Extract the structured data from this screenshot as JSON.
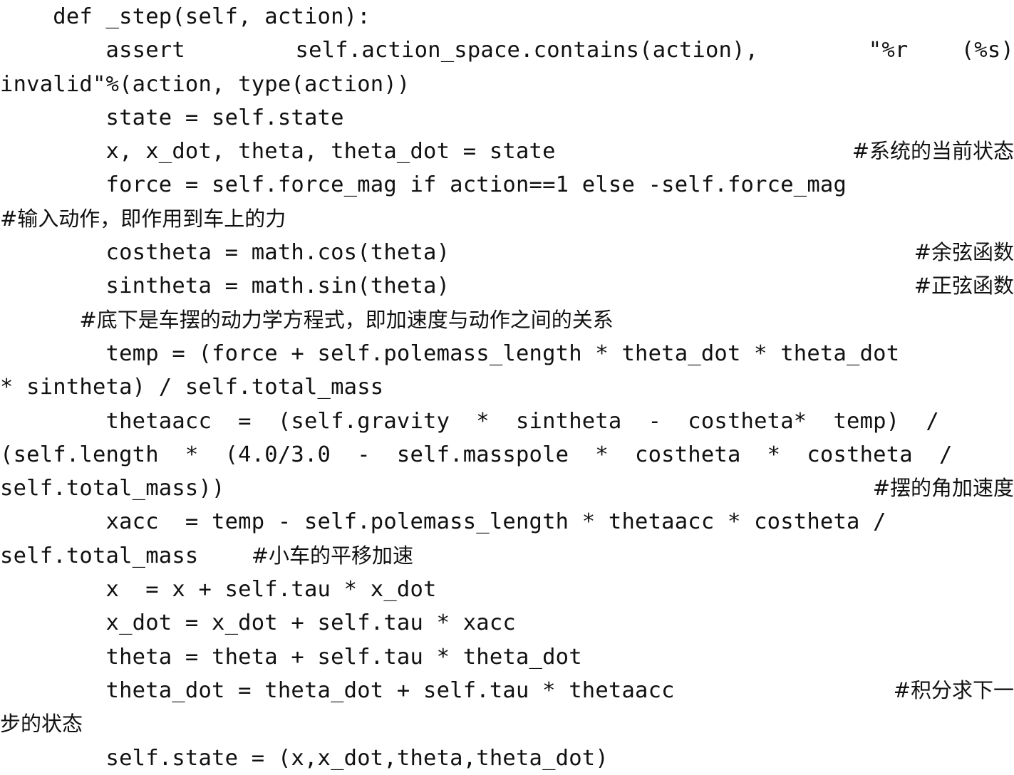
{
  "document": {
    "kind": "source-code-listing",
    "language": "Python",
    "function_name": "_step",
    "background_color": "#ffffff",
    "text_color": "#111111",
    "font_style": "monospace-serif",
    "text_alignment": "justified",
    "lines": [
      {
        "id": "line-1",
        "indent": "    ",
        "code": "def _step(self, action):",
        "comment": ""
      },
      {
        "id": "line-2",
        "indent": "        ",
        "code_left": "assert",
        "code_mid": "self.action_space.contains(action),",
        "code_right": "\"%r    (%s)",
        "comment": ""
      },
      {
        "id": "line-3",
        "indent": "",
        "code": "invalid\"%(action, type(action))",
        "comment": ""
      },
      {
        "id": "line-4",
        "indent": "        ",
        "code": "state = self.state",
        "comment": ""
      },
      {
        "id": "line-5",
        "indent": "        ",
        "code": "x, x_dot, theta, theta_dot = state",
        "comment": "#系统的当前状态"
      },
      {
        "id": "line-6",
        "indent": "        ",
        "code": "force = self.force_mag if action==1 else -self.force_mag",
        "comment": ""
      },
      {
        "id": "line-7",
        "indent": "",
        "code": "",
        "comment": "#输入动作，即作用到车上的力"
      },
      {
        "id": "line-8",
        "indent": "        ",
        "code": "costheta = math.cos(theta)",
        "comment": "#余弦函数"
      },
      {
        "id": "line-9",
        "indent": "        ",
        "code": "sintheta = math.sin(theta)",
        "comment": "#正弦函数"
      },
      {
        "id": "line-10",
        "indent": "      ",
        "code": "",
        "comment": "#底下是车摆的动力学方程式，即加速度与动作之间的关系"
      },
      {
        "id": "line-11",
        "indent": "        ",
        "code": "temp = (force + self.polemass_length * theta_dot * theta_dot",
        "comment": ""
      },
      {
        "id": "line-12",
        "indent": "",
        "code": "* sintheta) / self.total_mass",
        "comment": ""
      },
      {
        "id": "line-13",
        "indent": "        ",
        "code_left": "thetaacc  =  (self.gravity  *  sintheta  -  costheta*  temp)  /",
        "comment": ""
      },
      {
        "id": "line-14",
        "indent": "",
        "code": "(self.length  *  (4.0/3.0  -  self.masspole  *  costheta  *  costheta  /",
        "comment": ""
      },
      {
        "id": "line-15",
        "indent": "",
        "code": "self.total_mass))",
        "comment": "#摆的角加速度"
      },
      {
        "id": "line-16",
        "indent": "        ",
        "code": "xacc  = temp - self.polemass_length * thetaacc * costheta /",
        "comment": ""
      },
      {
        "id": "line-17",
        "indent": "",
        "code": "self.total_mass",
        "comment": "#小车的平移加速"
      },
      {
        "id": "line-18",
        "indent": "        ",
        "code": "x  = x + self.tau * x_dot",
        "comment": ""
      },
      {
        "id": "line-19",
        "indent": "        ",
        "code": "x_dot = x_dot + self.tau * xacc",
        "comment": ""
      },
      {
        "id": "line-20",
        "indent": "        ",
        "code": "theta = theta + self.tau * theta_dot",
        "comment": ""
      },
      {
        "id": "line-21",
        "indent": "        ",
        "code": "theta_dot = theta_dot + self.tau * thetaacc",
        "comment": "#积分求下一"
      },
      {
        "id": "line-22",
        "indent": "",
        "code": "",
        "comment": "步的状态"
      },
      {
        "id": "line-23",
        "indent": "        ",
        "code": "self.state = (x,x_dot,theta,theta_dot)",
        "comment": ""
      }
    ]
  }
}
